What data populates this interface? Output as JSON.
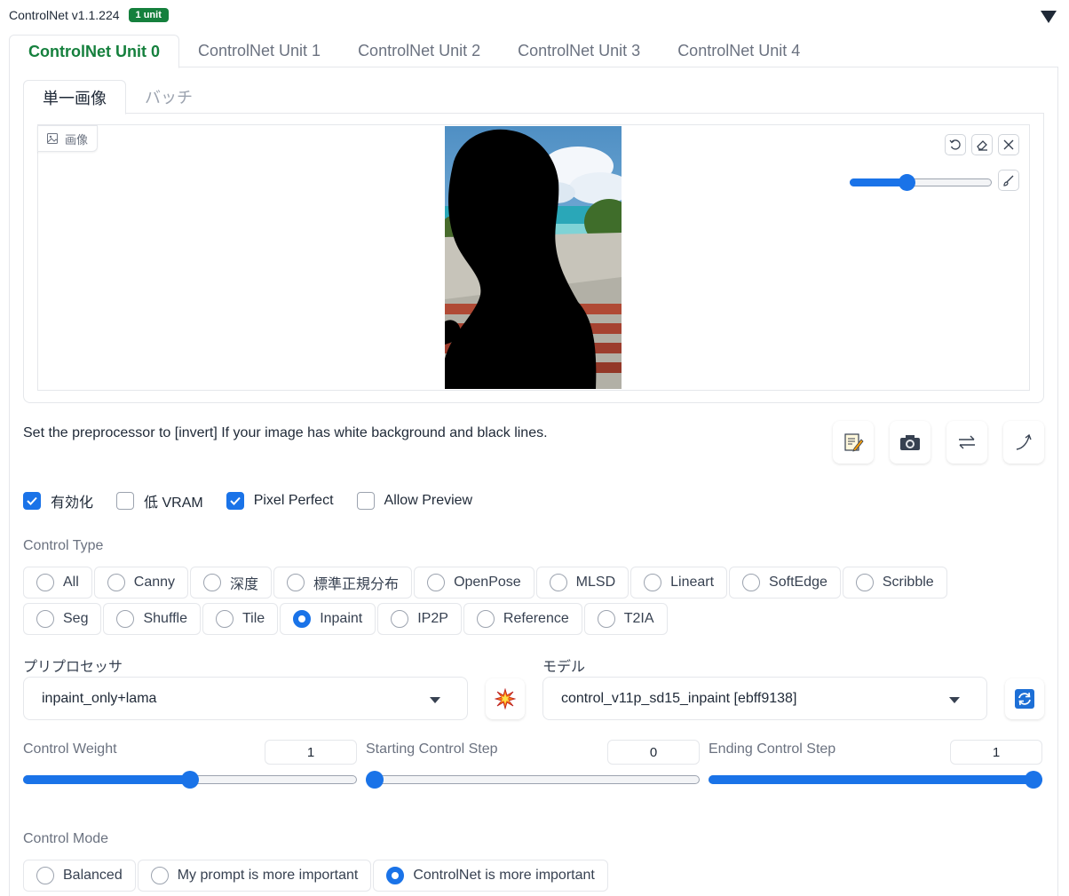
{
  "header": {
    "title": "ControlNet v1.1.224",
    "badge": "1 unit"
  },
  "unit_tabs": [
    {
      "label": "ControlNet Unit 0",
      "active": true
    },
    {
      "label": "ControlNet Unit 1"
    },
    {
      "label": "ControlNet Unit 2"
    },
    {
      "label": "ControlNet Unit 3"
    },
    {
      "label": "ControlNet Unit 4"
    }
  ],
  "image_tabs": [
    {
      "label": "単一画像",
      "active": true
    },
    {
      "label": "バッチ"
    }
  ],
  "image_panel": {
    "label": "画像",
    "tools": [
      "undo-icon",
      "eraser-icon",
      "close-icon",
      "brush-icon"
    ],
    "brush_size_fraction": 0.4
  },
  "hint": "Set the preprocessor to [invert] If your image has white background and black lines.",
  "action_buttons": [
    "edit-icon",
    "camera-icon",
    "swap-icon",
    "send-dimensions-icon"
  ],
  "checkboxes": [
    {
      "label": "有効化",
      "checked": true
    },
    {
      "label": "低 VRAM",
      "checked": false
    },
    {
      "label": "Pixel Perfect",
      "checked": true
    },
    {
      "label": "Allow Preview",
      "checked": false
    }
  ],
  "control_type": {
    "label": "Control Type",
    "row1": [
      "All",
      "Canny",
      "深度",
      "標準正規分布",
      "OpenPose",
      "MLSD",
      "Lineart",
      "SoftEdge",
      "Scribble"
    ],
    "row2": [
      "Seg",
      "Shuffle",
      "Tile",
      "Inpaint",
      "IP2P",
      "Reference",
      "T2IA"
    ],
    "selected": "Inpaint"
  },
  "preprocessor": {
    "label": "プリプロセッサ",
    "value": "inpaint_only+lama"
  },
  "model": {
    "label": "モデル",
    "value": "control_v11p_sd15_inpaint [ebff9138]"
  },
  "sliders": [
    {
      "label": "Control Weight",
      "value": "1",
      "min": 0,
      "max": 2,
      "fraction": 0.5
    },
    {
      "label": "Starting Control Step",
      "value": "0",
      "min": 0,
      "max": 1,
      "fraction": 0.0
    },
    {
      "label": "Ending Control Step",
      "value": "1",
      "min": 0,
      "max": 1,
      "fraction": 1.0
    }
  ],
  "control_mode": {
    "label": "Control Mode",
    "options": [
      "Balanced",
      "My prompt is more important",
      "ControlNet is more important"
    ],
    "selected": "ControlNet is more important"
  },
  "colors": {
    "accent": "#1a73e8",
    "active_tab": "#15803d",
    "badge": "#15803d"
  }
}
